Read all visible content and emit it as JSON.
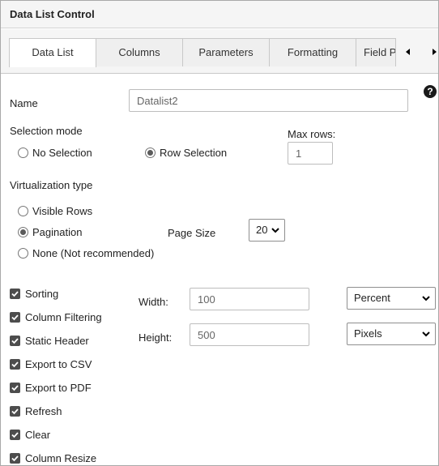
{
  "window": {
    "title": "Data List Control"
  },
  "tabs": [
    {
      "label": "Data List",
      "active": true
    },
    {
      "label": "Columns"
    },
    {
      "label": "Parameters"
    },
    {
      "label": "Formatting"
    },
    {
      "label": "Field P"
    }
  ],
  "tab_scroll": {
    "left_icon": "triangle-left",
    "right_icon": "triangle-right"
  },
  "name": {
    "label": "Name",
    "value": "Datalist2"
  },
  "help_icon": "?",
  "selection_mode": {
    "label": "Selection mode",
    "options": [
      {
        "label": "No Selection",
        "selected": false
      },
      {
        "label": "Row Selection",
        "selected": true
      }
    ]
  },
  "max_rows": {
    "label": "Max rows:",
    "value": "1"
  },
  "virtualization": {
    "label": "Virtualization type",
    "options": [
      {
        "label": "Visible Rows",
        "selected": false
      },
      {
        "label": "Pagination",
        "selected": true
      },
      {
        "label": "None (Not recommended)",
        "selected": false
      }
    ]
  },
  "page_size": {
    "label": "Page Size",
    "value": "20"
  },
  "features": [
    {
      "label": "Sorting",
      "checked": true
    },
    {
      "label": "Column Filtering",
      "checked": true
    },
    {
      "label": "Static Header",
      "checked": true
    },
    {
      "label": "Export to CSV",
      "checked": true
    },
    {
      "label": "Export to PDF",
      "checked": true
    },
    {
      "label": "Refresh",
      "checked": true
    },
    {
      "label": "Clear",
      "checked": true
    },
    {
      "label": "Column Resize",
      "checked": true
    }
  ],
  "width": {
    "label": "Width:",
    "value": "100",
    "unit": "Percent"
  },
  "height": {
    "label": "Height:",
    "value": "500",
    "unit": "Pixels"
  }
}
